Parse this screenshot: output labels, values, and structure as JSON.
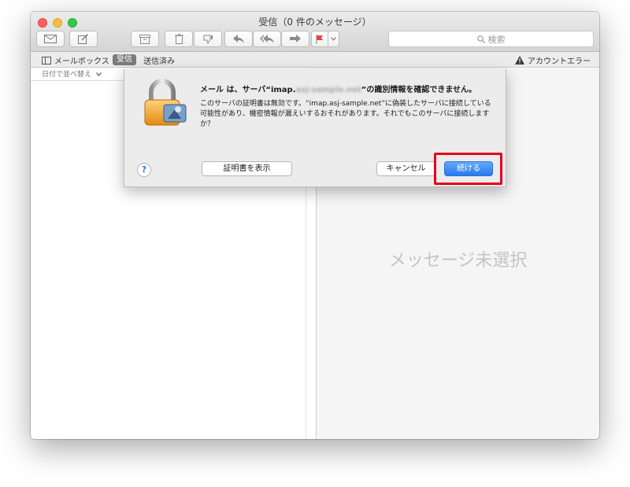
{
  "window": {
    "title": "受信（0 件のメッセージ）"
  },
  "toolbar": {
    "search_placeholder": "検索",
    "icons": [
      "envelope-icon",
      "compose-icon",
      "archive-icon",
      "trash-icon",
      "junk-icon",
      "reply-icon",
      "reply-all-icon",
      "forward-icon",
      "flag-icon",
      "chevron-down-icon",
      "search-icon"
    ],
    "flag_color": "#e8433f"
  },
  "favorites": {
    "mailboxes_label": "メールボックス",
    "inbox_label": "受信",
    "sent_label": "送信済み",
    "account_error_label": "アカウントエラー"
  },
  "sortbar": {
    "label": "日付で並べ替え"
  },
  "message_pane": {
    "empty_text": "メッセージ未選択"
  },
  "dialog": {
    "title_prefix": "メール は、サーバ“imap.",
    "title_blurred": "asj-sample.net",
    "title_suffix": "”の識別情報を確認できません。",
    "body": "このサーバの証明書は無効です。“imap.asj-sample.net”に偽装したサーバに接続している可能性があり、機密情報が漏えいするおそれがあります。それでもこのサーバに接続しますか？",
    "help_label": "?",
    "show_cert_label": "証明書を表示",
    "cancel_label": "キャンセル",
    "continue_label": "続ける",
    "accent_color": "#2779ee",
    "highlight_color": "#e3001b"
  }
}
